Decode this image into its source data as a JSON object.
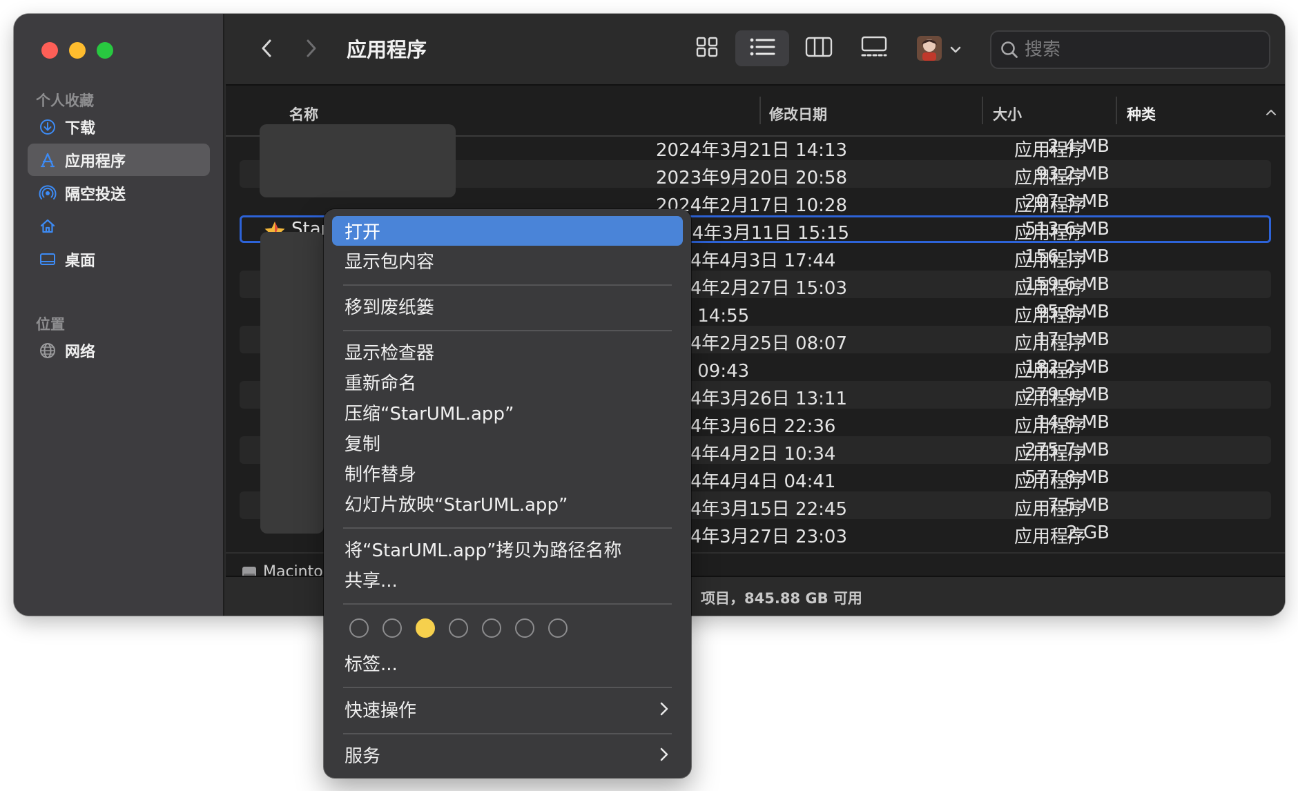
{
  "window": {
    "title": "应用程序"
  },
  "sidebar": {
    "favorites_heading": "个人收藏",
    "items": [
      {
        "label": "下载",
        "icon": "download-icon"
      },
      {
        "label": "应用程序",
        "icon": "apps-icon",
        "active": true
      },
      {
        "label": "隔空投送",
        "icon": "airdrop-icon"
      },
      {
        "label": "",
        "icon": "home-icon"
      },
      {
        "label": "桌面",
        "icon": "desktop-icon"
      }
    ],
    "locations_heading": "位置",
    "locations": [
      {
        "label": "网络",
        "icon": "network-icon"
      }
    ]
  },
  "toolbar": {
    "search_placeholder": "搜索",
    "views": [
      "icon-view",
      "list-view",
      "column-view",
      "gallery-view"
    ],
    "active_view": "list-view"
  },
  "columns": {
    "name": "名称",
    "date": "修改日期",
    "size": "大小",
    "kind": "种类"
  },
  "rows": [
    {
      "name": "",
      "date": "2024年3月21日 14:13",
      "size": "2.4 MB",
      "kind": "应用程序"
    },
    {
      "name": "",
      "date": "2023年9月20日 20:58",
      "size": "93.2 MB",
      "kind": "应用程序"
    },
    {
      "name": "",
      "date": "2024年2月17日 10:28",
      "size": "207.3 MB",
      "kind": "应用程序"
    },
    {
      "name": "Star",
      "date": "2024年3月11日 15:15",
      "size": "513.6 MB",
      "kind": "应用程序",
      "selected": true
    },
    {
      "name": "",
      "date": "2024年4月3日 17:44",
      "size": "156.1 MB",
      "kind": "应用程序"
    },
    {
      "name": "",
      "date": "2024年2月27日 15:03",
      "size": "159.6 MB",
      "kind": "应用程序"
    },
    {
      "name": "",
      "date": "今天 14:55",
      "size": "95.8 MB",
      "kind": "应用程序"
    },
    {
      "name": "",
      "date": "2024年2月25日 08:07",
      "size": "17.1 MB",
      "kind": "应用程序"
    },
    {
      "name": "",
      "date": "昨天 09:43",
      "size": "182.2 MB",
      "kind": "应用程序"
    },
    {
      "name": "",
      "date": "2024年3月26日 13:11",
      "size": "279.9 MB",
      "kind": "应用程序"
    },
    {
      "name": "",
      "date": "2024年3月6日 22:36",
      "size": "14.8 MB",
      "kind": "应用程序"
    },
    {
      "name": "",
      "date": "2024年4月2日 10:34",
      "size": "275.7 MB",
      "kind": "应用程序"
    },
    {
      "name": "",
      "date": "2024年4月4日 04:41",
      "size": "577.8 MB",
      "kind": "应用程序"
    },
    {
      "name": "",
      "date": "2024年3月15日 22:45",
      "size": "7.5 MB",
      "kind": "应用程序"
    },
    {
      "name": "",
      "date": "2024年3月27日 23:03",
      "size": "2 GB",
      "kind": "应用程序"
    }
  ],
  "path_bar": {
    "label": "Macinto"
  },
  "status_bar": {
    "text": "项目，845.88 GB 可用"
  },
  "context_menu": {
    "open": "打开",
    "show_package": "显示包内容",
    "move_to_trash": "移到废纸篓",
    "show_inspector": "显示检查器",
    "rename": "重新命名",
    "compress": "压缩“StarUML.app”",
    "duplicate": "复制",
    "make_alias": "制作替身",
    "slideshow": "幻灯片放映“StarUML.app”",
    "copy_path": "将“StarUML.app”拷贝为路径名称",
    "share": "共享...",
    "tags": "标签...",
    "quick_actions": "快速操作",
    "services": "服务",
    "tag_colors": [
      "none",
      "none",
      "#f6d04d",
      "none",
      "none",
      "none",
      "none"
    ]
  },
  "colors": {
    "accent": "#2d63d8",
    "highlight": "#4a84d8",
    "tag_yellow": "#f6d04d"
  }
}
